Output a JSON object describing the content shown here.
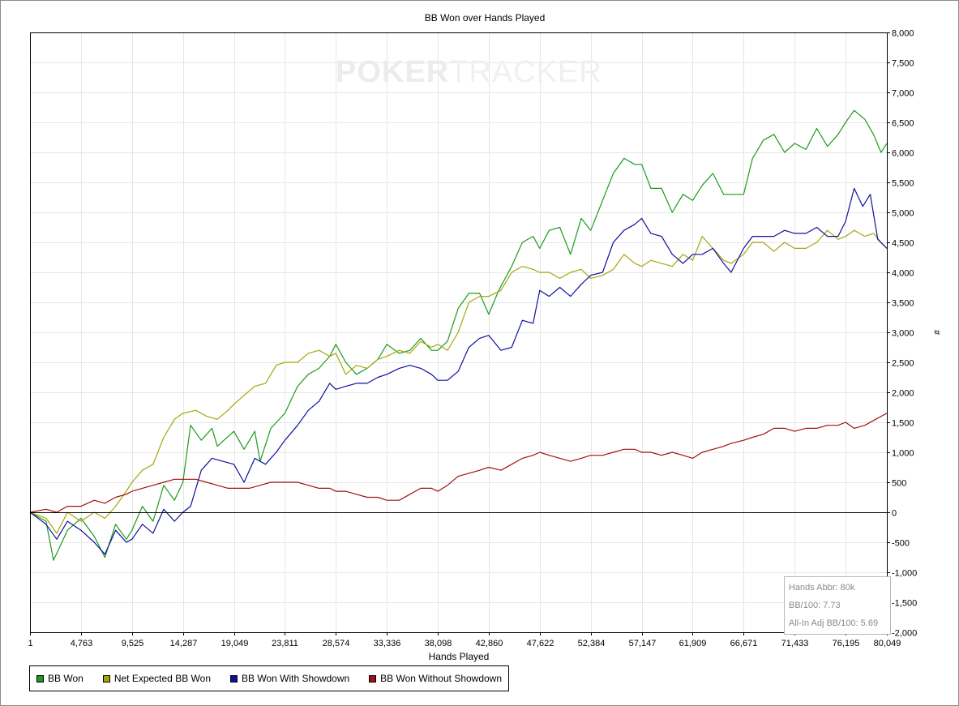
{
  "chart_data": {
    "type": "line",
    "title": "BB Won over Hands Played",
    "xlabel": "Hands Played",
    "ylabel": "#",
    "xlim": [
      1,
      80049
    ],
    "ylim": [
      -2000,
      8000
    ],
    "x_ticks": [
      1,
      4763,
      9525,
      14287,
      19049,
      23811,
      28574,
      33336,
      38098,
      42860,
      47622,
      52384,
      57147,
      61909,
      66671,
      71433,
      76195,
      80049
    ],
    "x_tick_labels": [
      "1",
      "4,763",
      "9,525",
      "14,287",
      "19,049",
      "23,811",
      "28,574",
      "33,336",
      "38,098",
      "42,860",
      "47,622",
      "52,384",
      "57,147",
      "61,909",
      "66,671",
      "71,433",
      "76,195",
      "80,049"
    ],
    "y_ticks": [
      -2000,
      -1500,
      -1000,
      -500,
      0,
      500,
      1000,
      1500,
      2000,
      2500,
      3000,
      3500,
      4000,
      4500,
      5000,
      5500,
      6000,
      6500,
      7000,
      7500,
      8000
    ],
    "y_tick_labels": [
      "-2,000",
      "-1,500",
      "-1,000",
      "-500",
      "0",
      "500",
      "1,000",
      "1,500",
      "2,000",
      "2,500",
      "3,000",
      "3,500",
      "4,000",
      "4,500",
      "5,000",
      "5,500",
      "6,000",
      "6,500",
      "7,000",
      "7,500",
      "8,000"
    ],
    "grid": true,
    "legend_position": "bottom-left",
    "series": [
      {
        "name": "BB Won",
        "color": "#1a9c1a",
        "x": [
          1,
          1500,
          2200,
          3500,
          4763,
          6000,
          7000,
          8000,
          9000,
          9525,
          10500,
          11500,
          12500,
          13500,
          14287,
          15000,
          16000,
          17000,
          17500,
          19049,
          20000,
          21000,
          21500,
          22500,
          23811,
          25000,
          26000,
          27000,
          28000,
          28574,
          29500,
          30500,
          31500,
          32500,
          33336,
          34500,
          35500,
          36500,
          37500,
          38098,
          39000,
          40000,
          41000,
          42000,
          42860,
          43800,
          45000,
          46000,
          47000,
          47622,
          48500,
          49500,
          50500,
          51500,
          52384,
          53500,
          54500,
          55500,
          56500,
          57147,
          58000,
          59000,
          60000,
          61000,
          61909,
          62800,
          63800,
          64800,
          65500,
          66671,
          67500,
          68500,
          69500,
          70500,
          71433,
          72500,
          73500,
          74500,
          75500,
          76195,
          77000,
          78000,
          78800,
          79500,
          80049
        ],
        "y": [
          0,
          -150,
          -800,
          -300,
          -100,
          -400,
          -750,
          -200,
          -450,
          -300,
          100,
          -150,
          450,
          200,
          500,
          1450,
          1200,
          1400,
          1100,
          1350,
          1050,
          1350,
          850,
          1400,
          1650,
          2100,
          2300,
          2400,
          2600,
          2800,
          2500,
          2300,
          2400,
          2550,
          2800,
          2650,
          2700,
          2900,
          2700,
          2700,
          2850,
          3400,
          3650,
          3650,
          3300,
          3700,
          4100,
          4500,
          4600,
          4400,
          4700,
          4750,
          4300,
          4900,
          4700,
          5200,
          5650,
          5900,
          5800,
          5800,
          5400,
          5400,
          5000,
          5300,
          5200,
          5450,
          5650,
          5300,
          5300,
          5300,
          5900,
          6200,
          6300,
          6000,
          6150,
          6050,
          6400,
          6100,
          6300,
          6500,
          6700,
          6550,
          6300,
          6000,
          6150
        ]
      },
      {
        "name": "Net Expected BB Won",
        "color": "#a6a60c",
        "x": [
          1,
          1500,
          2500,
          3500,
          4763,
          6000,
          7000,
          8000,
          9000,
          9525,
          10500,
          11500,
          12500,
          13500,
          14287,
          15500,
          16500,
          17500,
          18500,
          19049,
          20000,
          21000,
          22000,
          23000,
          23811,
          25000,
          26000,
          27000,
          28000,
          28574,
          29500,
          30500,
          31500,
          32500,
          33336,
          34500,
          35500,
          36500,
          37500,
          38098,
          39000,
          40000,
          41000,
          42000,
          42860,
          44000,
          45000,
          46000,
          47000,
          47622,
          48500,
          49500,
          50500,
          51500,
          52384,
          53500,
          54500,
          55500,
          56500,
          57147,
          58000,
          59000,
          60000,
          61000,
          61909,
          62800,
          63800,
          64800,
          65500,
          66671,
          67500,
          68500,
          69500,
          70500,
          71433,
          72500,
          73500,
          74500,
          75500,
          76195,
          77000,
          78000,
          78800,
          79500,
          80049
        ],
        "y": [
          0,
          -100,
          -350,
          0,
          -150,
          0,
          -100,
          100,
          350,
          500,
          700,
          800,
          1250,
          1550,
          1650,
          1700,
          1600,
          1550,
          1700,
          1800,
          1950,
          2100,
          2150,
          2450,
          2500,
          2500,
          2650,
          2700,
          2600,
          2650,
          2300,
          2450,
          2400,
          2550,
          2600,
          2700,
          2650,
          2850,
          2750,
          2800,
          2700,
          3000,
          3500,
          3600,
          3600,
          3700,
          4000,
          4100,
          4050,
          4000,
          4000,
          3900,
          4000,
          4050,
          3900,
          3950,
          4050,
          4300,
          4150,
          4100,
          4200,
          4150,
          4100,
          4300,
          4200,
          4600,
          4400,
          4200,
          4150,
          4300,
          4500,
          4500,
          4350,
          4500,
          4400,
          4400,
          4500,
          4700,
          4550,
          4600,
          4700,
          4600,
          4650,
          4500,
          4400
        ]
      },
      {
        "name": "BB Won With Showdown",
        "color": "#10109e",
        "x": [
          1,
          1500,
          2500,
          3500,
          4763,
          6000,
          7000,
          8000,
          9000,
          9525,
          10500,
          11500,
          12500,
          13500,
          14287,
          15000,
          16000,
          17000,
          18000,
          19049,
          20000,
          21000,
          22000,
          23000,
          23811,
          25000,
          26000,
          27000,
          28000,
          28574,
          29500,
          30500,
          31500,
          32500,
          33336,
          34500,
          35500,
          36500,
          37500,
          38098,
          39000,
          40000,
          41000,
          42000,
          42860,
          44000,
          45000,
          46000,
          47000,
          47622,
          48500,
          49500,
          50500,
          51500,
          52384,
          53500,
          54500,
          55500,
          56500,
          57147,
          58000,
          59000,
          60000,
          61000,
          61909,
          62800,
          63800,
          64800,
          65500,
          66671,
          67500,
          68500,
          69500,
          70500,
          71433,
          72500,
          73500,
          74500,
          75500,
          76195,
          77000,
          77800,
          78500,
          79200,
          80049
        ],
        "y": [
          0,
          -200,
          -450,
          -150,
          -300,
          -500,
          -700,
          -300,
          -500,
          -450,
          -200,
          -350,
          50,
          -150,
          0,
          100,
          700,
          900,
          850,
          800,
          500,
          900,
          800,
          1000,
          1200,
          1450,
          1700,
          1850,
          2150,
          2050,
          2100,
          2150,
          2150,
          2250,
          2300,
          2400,
          2450,
          2400,
          2300,
          2200,
          2200,
          2350,
          2750,
          2900,
          2950,
          2700,
          2750,
          3200,
          3150,
          3700,
          3600,
          3750,
          3600,
          3800,
          3950,
          4000,
          4500,
          4700,
          4800,
          4900,
          4650,
          4600,
          4300,
          4150,
          4300,
          4300,
          4400,
          4150,
          4000,
          4400,
          4600,
          4600,
          4600,
          4700,
          4650,
          4650,
          4750,
          4600,
          4600,
          4850,
          5400,
          5100,
          5300,
          4550,
          4400
        ]
      },
      {
        "name": "BB Won Without Showdown",
        "color": "#a11111",
        "x": [
          1,
          1500,
          2500,
          3500,
          4763,
          6000,
          7000,
          8000,
          9000,
          9525,
          10500,
          11500,
          12500,
          13500,
          14287,
          15500,
          16500,
          17500,
          18500,
          19049,
          20500,
          21500,
          22500,
          23811,
          25000,
          26000,
          27000,
          28000,
          28574,
          29500,
          30500,
          31500,
          32500,
          33336,
          34500,
          35500,
          36500,
          37500,
          38098,
          39000,
          40000,
          41000,
          42000,
          42860,
          44000,
          45000,
          46000,
          47000,
          47622,
          48500,
          49500,
          50500,
          51500,
          52384,
          53500,
          54500,
          55500,
          56500,
          57147,
          58000,
          59000,
          60000,
          61000,
          61909,
          62800,
          63800,
          64800,
          65500,
          66671,
          67500,
          68500,
          69500,
          70500,
          71433,
          72500,
          73500,
          74500,
          75500,
          76195,
          77000,
          78000,
          79000,
          80049
        ],
        "y": [
          0,
          50,
          0,
          100,
          100,
          200,
          150,
          250,
          300,
          350,
          400,
          450,
          500,
          550,
          550,
          550,
          500,
          450,
          400,
          400,
          400,
          450,
          500,
          500,
          500,
          450,
          400,
          400,
          350,
          350,
          300,
          250,
          250,
          200,
          200,
          300,
          400,
          400,
          350,
          450,
          600,
          650,
          700,
          750,
          700,
          800,
          900,
          950,
          1000,
          950,
          900,
          850,
          900,
          950,
          950,
          1000,
          1050,
          1050,
          1000,
          1000,
          950,
          1000,
          950,
          900,
          1000,
          1050,
          1100,
          1150,
          1200,
          1250,
          1300,
          1400,
          1400,
          1350,
          1400,
          1400,
          1450,
          1450,
          1500,
          1400,
          1450,
          1550,
          1650
        ]
      }
    ]
  },
  "stats": {
    "hands_abbr": "Hands Abbr: 80k",
    "bb_per_100": "BB/100: 7.73",
    "allin_adj_bb_per_100": "All-In Adj BB/100: 5.69"
  },
  "watermark": {
    "bold_text": "POKER",
    "light_text": "TRACKER"
  }
}
